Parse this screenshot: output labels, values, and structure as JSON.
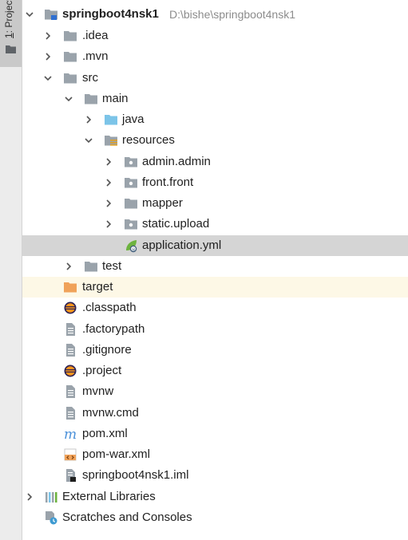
{
  "side_panel": {
    "tab_number": "1",
    "tab_label": ": Project"
  },
  "tree": {
    "root": {
      "name": "springboot4nsk1",
      "path": "D:\\bishe\\springboot4nsk1"
    },
    "idea": ".idea",
    "mvn": ".mvn",
    "src": "src",
    "main": "main",
    "java": "java",
    "resources": "resources",
    "admin": "admin.admin",
    "front": "front.front",
    "mapper": "mapper",
    "static_upload": "static.upload",
    "application_yml": "application.yml",
    "test": "test",
    "target": "target",
    "classpath": ".classpath",
    "factorypath": ".factorypath",
    "gitignore": ".gitignore",
    "project": ".project",
    "mvnw": "mvnw",
    "mvnw_cmd": "mvnw.cmd",
    "pom_xml": "pom.xml",
    "pom_war_xml": "pom-war.xml",
    "iml": "springboot4nsk1.iml",
    "external_libraries": "External Libraries",
    "scratches": "Scratches and Consoles"
  },
  "colors": {
    "selection": "#d5d5d5",
    "excluded_row": "#fdf8e6",
    "folder_gray": "#9aa3ab",
    "source_folder_blue": "#7cc4e8",
    "excluded_folder_orange": "#f0a25a",
    "path_gray": "#8c8c8c"
  }
}
